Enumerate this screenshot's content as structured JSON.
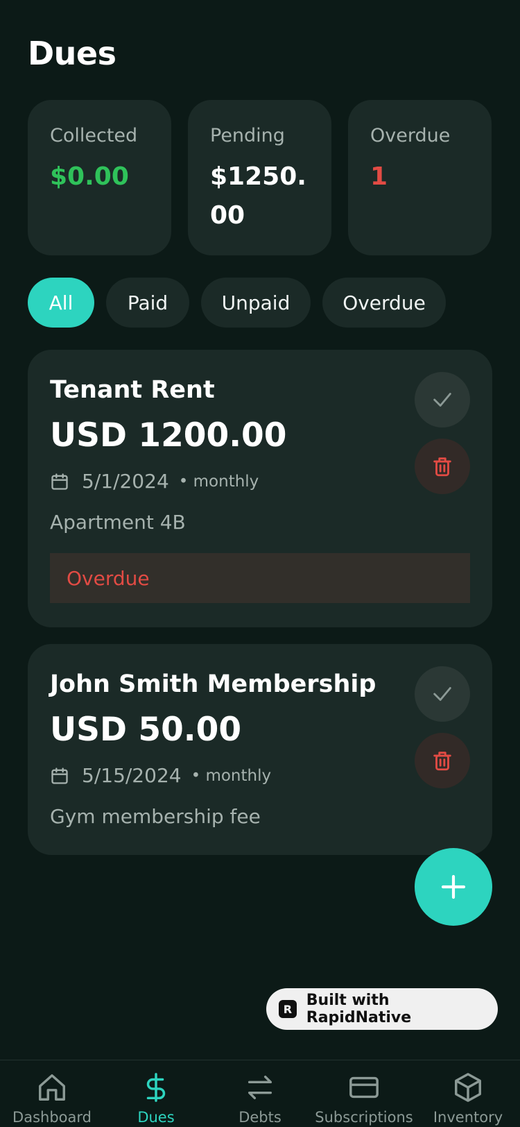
{
  "header": {
    "title": "Dues"
  },
  "stats": [
    {
      "label": "Collected",
      "value": "$0.00",
      "color": "#2fc25a"
    },
    {
      "label": "Pending",
      "value": "$1250.00",
      "color": "#ffffff"
    },
    {
      "label": "Overdue",
      "value": "1",
      "color": "#e24b44"
    }
  ],
  "filters": [
    {
      "label": "All",
      "active": true
    },
    {
      "label": "Paid",
      "active": false
    },
    {
      "label": "Unpaid",
      "active": false
    },
    {
      "label": "Overdue",
      "active": false
    }
  ],
  "dues": [
    {
      "title": "Tenant Rent",
      "amount": "USD 1200.00",
      "date": "5/1/2024",
      "frequency": "• monthly",
      "description": "Apartment 4B",
      "status": "Overdue"
    },
    {
      "title": "John Smith Membership",
      "amount": "USD 50.00",
      "date": "5/15/2024",
      "frequency": "• monthly",
      "description": "Gym membership fee"
    }
  ],
  "fab": {
    "icon": "plus-icon"
  },
  "badge": {
    "text": "Built with RapidNative"
  },
  "tabbar": [
    {
      "label": "Dashboard",
      "icon": "home-icon"
    },
    {
      "label": "Dues",
      "icon": "dollar-icon",
      "active": true
    },
    {
      "label": "Debts",
      "icon": "arrows-icon"
    },
    {
      "label": "Subscriptions",
      "icon": "card-icon"
    },
    {
      "label": "Inventory",
      "icon": "box-icon"
    }
  ],
  "colors": {
    "accent": "#2dd4bf",
    "danger": "#e24b44",
    "success": "#2fc25a",
    "background": "#0c1a17",
    "card": "#1b2a27"
  }
}
